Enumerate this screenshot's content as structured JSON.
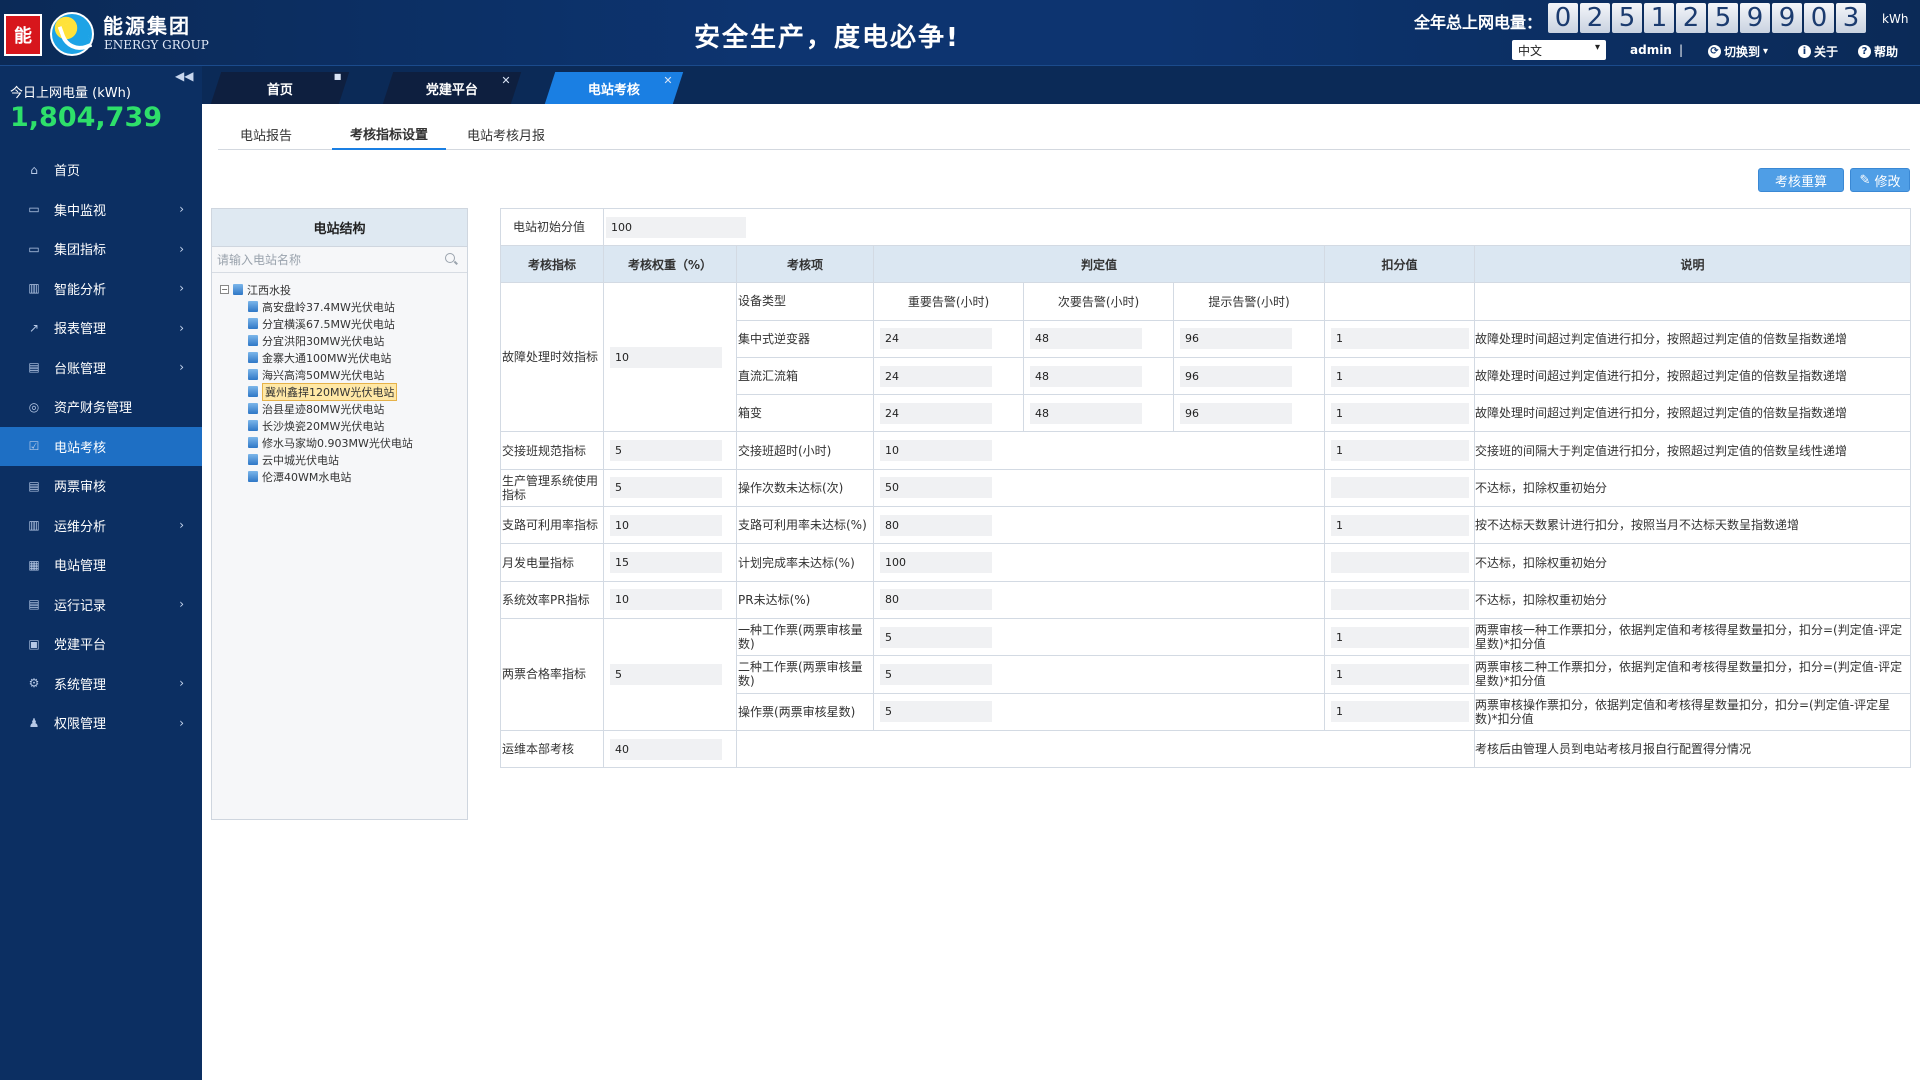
{
  "header": {
    "logo_text": "能",
    "brand_cn": "能源集团",
    "brand_en": "ENERGY GROUP",
    "slogan": "安全生产，度电必争!",
    "total_label": "全年总上网电量：",
    "total_digits": [
      "0",
      "2",
      "5",
      "1",
      "2",
      "5",
      "9",
      "9",
      "0",
      "3"
    ],
    "total_unit": "kWh",
    "language": "中文",
    "user": "admin",
    "separator": "|",
    "switch_label": "切换到",
    "about_label": "关于",
    "help_label": "帮助"
  },
  "sidebar": {
    "today_label": "今日上网电量 (kWh)",
    "today_value": "1,804,739",
    "items": [
      {
        "label": "首页",
        "icon": "home-icon",
        "glyph": "⌂",
        "has_arrow": false
      },
      {
        "label": "集中监视",
        "icon": "monitor-icon",
        "glyph": "▭",
        "has_arrow": true
      },
      {
        "label": "集团指标",
        "icon": "screen-icon",
        "glyph": "▭",
        "has_arrow": true
      },
      {
        "label": "智能分析",
        "icon": "bar-chart-icon",
        "glyph": "▥",
        "has_arrow": true
      },
      {
        "label": "报表管理",
        "icon": "line-chart-icon",
        "glyph": "↗",
        "has_arrow": true
      },
      {
        "label": "台账管理",
        "icon": "ledger-icon",
        "glyph": "▤",
        "has_arrow": true
      },
      {
        "label": "资产财务管理",
        "icon": "finance-icon",
        "glyph": "◎",
        "has_arrow": false
      },
      {
        "label": "电站考核",
        "icon": "check-icon",
        "glyph": "☑",
        "has_arrow": false,
        "active": true
      },
      {
        "label": "两票审核",
        "icon": "ticket-icon",
        "glyph": "▤",
        "has_arrow": false
      },
      {
        "label": "运维分析",
        "icon": "ops-chart-icon",
        "glyph": "▥",
        "has_arrow": true
      },
      {
        "label": "电站管理",
        "icon": "grid-icon",
        "glyph": "▦",
        "has_arrow": false
      },
      {
        "label": "运行记录",
        "icon": "record-icon",
        "glyph": "▤",
        "has_arrow": true
      },
      {
        "label": "党建平台",
        "icon": "party-icon",
        "glyph": "▣",
        "has_arrow": false
      },
      {
        "label": "系统管理",
        "icon": "gear-icon",
        "glyph": "⚙",
        "has_arrow": true
      },
      {
        "label": "权限管理",
        "icon": "users-icon",
        "glyph": "♟",
        "has_arrow": true
      }
    ]
  },
  "tabs": [
    {
      "label": "首页",
      "closable": false
    },
    {
      "label": "党建平台",
      "closable": true
    },
    {
      "label": "电站考核",
      "closable": true,
      "active": true
    }
  ],
  "subtabs": [
    {
      "label": "电站报告"
    },
    {
      "label": "考核指标设置",
      "active": true
    },
    {
      "label": "电站考核月报"
    }
  ],
  "buttons": {
    "recalc": "考核重算",
    "edit": "修改"
  },
  "tree": {
    "title": "电站结构",
    "search_placeholder": "请输入电站名称",
    "root": "江西水投",
    "children": [
      "高安盘岭37.4MW光伏电站",
      "分宜横溪67.5MW光伏电站",
      "分宜洪阳30MW光伏电站",
      "金寨大通100MW光伏电站",
      "海兴高湾50MW光伏电站",
      "冀州鑫捍120MW光伏电站",
      "治县星迹80MW光伏电站",
      "长沙焕瓷20MW光伏电站",
      "修水马家坳0.903MW光伏电站",
      "云中城光伏电站",
      "伦潭40WM水电站"
    ],
    "selected_index": 5
  },
  "table": {
    "initial_label": "电站初始分值",
    "initial_value": "100",
    "headers": [
      "考核指标",
      "考核权重（%）",
      "考核项",
      "判定值",
      "扣分值",
      "说明"
    ],
    "sub_headers": {
      "device": "设备类型",
      "major": "重要告警(小时)",
      "minor": "次要告警(小时)",
      "hint": "提示告警(小时)"
    },
    "fault": {
      "label": "故障处理时效指标",
      "weight": "10",
      "rows": [
        {
          "item": "集中式逆变器",
          "major": "24",
          "minor": "48",
          "hint": "96",
          "deduct": "1",
          "desc": "故障处理时间超过判定值进行扣分，按照超过判定值的倍数呈指数递增"
        },
        {
          "item": "直流汇流箱",
          "major": "24",
          "minor": "48",
          "hint": "96",
          "deduct": "1",
          "desc": "故障处理时间超过判定值进行扣分，按照超过判定值的倍数呈指数递增"
        },
        {
          "item": "箱变",
          "major": "24",
          "minor": "48",
          "hint": "96",
          "deduct": "1",
          "desc": "故障处理时间超过判定值进行扣分，按照超过判定值的倍数呈指数递增"
        }
      ]
    },
    "single_rows": [
      {
        "label": "交接班规范指标",
        "weight": "5",
        "item": "交接班超时(小时)",
        "value": "10",
        "deduct": "1",
        "desc": "交接班的间隔大于判定值进行扣分，按照超过判定值的倍数呈线性递增"
      },
      {
        "label": "生产管理系统使用指标",
        "weight": "5",
        "item": "操作次数未达标(次)",
        "value": "50",
        "deduct": "",
        "desc": "不达标，扣除权重初始分"
      },
      {
        "label": "支路可利用率指标",
        "weight": "10",
        "item": "支路可利用率未达标(%)",
        "value": "80",
        "deduct": "1",
        "desc": "按不达标天数累计进行扣分，按照当月不达标天数呈指数递增"
      },
      {
        "label": "月发电量指标",
        "weight": "15",
        "item": "计划完成率未达标(%)",
        "value": "100",
        "deduct": "",
        "desc": "不达标，扣除权重初始分"
      },
      {
        "label": "系统效率PR指标",
        "weight": "10",
        "item": "PR未达标(%)",
        "value": "80",
        "deduct": "",
        "desc": "不达标，扣除权重初始分"
      }
    ],
    "tickets": {
      "label": "两票合格率指标",
      "weight": "5",
      "rows": [
        {
          "item": "一种工作票(两票审核量数)",
          "value": "5",
          "deduct": "1",
          "desc": "两票审核一种工作票扣分，依据判定值和考核得星数量扣分，扣分=(判定值-评定星数)*扣分值"
        },
        {
          "item": "二种工作票(两票审核量数)",
          "value": "5",
          "deduct": "1",
          "desc": "两票审核二种工作票扣分，依据判定值和考核得星数量扣分，扣分=(判定值-评定星数)*扣分值"
        },
        {
          "item": "操作票(两票审核星数)",
          "value": "5",
          "deduct": "1",
          "desc": "两票审核操作票扣分，依据判定值和考核得星数量扣分，扣分=(判定值-评定星数)*扣分值"
        }
      ]
    },
    "ops": {
      "label": "运维本部考核",
      "weight": "40",
      "desc": "考核后由管理人员到电站考核月报自行配置得分情况"
    }
  }
}
